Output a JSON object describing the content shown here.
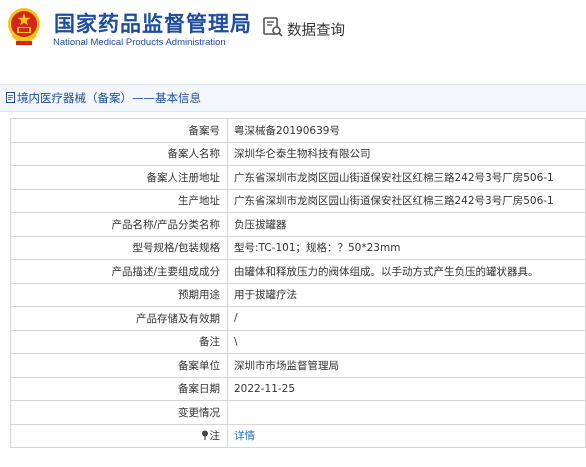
{
  "header": {
    "title_cn": "国家药品监督管理局",
    "title_en": "National Medical Products Administration",
    "search_label": "数据查询",
    "emblem_icon": "national-emblem-icon",
    "search_icon": "search-document-icon"
  },
  "section": {
    "title": "境内医疗器械（备案）——基本信息",
    "icon": "document-icon"
  },
  "rows": [
    {
      "label": "备案号",
      "value": "粤深械备20190639号"
    },
    {
      "label": "备案人名称",
      "value": "深圳华仑泰生物科技有限公司"
    },
    {
      "label": "备案人注册地址",
      "value": "广东省深圳市龙岗区园山街道保安社区红棉三路242号3号厂房506-1"
    },
    {
      "label": "生产地址",
      "value": "广东省深圳市龙岗区园山街道保安社区红棉三路242号3号厂房506-1"
    },
    {
      "label": "产品名称/产品分类名称",
      "value": "负压拔罐器"
    },
    {
      "label": "型号规格/包装规格",
      "value": "型号:TC-101；规格：？50*23mm"
    },
    {
      "label": "产品描述/主要组成成分",
      "value": "由罐体和释放压力的阀体组成。以手动方式产生负压的罐状器具。"
    },
    {
      "label": "预期用途",
      "value": "用于拔罐疗法"
    },
    {
      "label": "产品存储及有效期",
      "value": "/"
    },
    {
      "label": "备注",
      "value": "\\"
    },
    {
      "label": "备案单位",
      "value": "深圳市市场监督管理局"
    },
    {
      "label": "备案日期",
      "value": "2022-11-25"
    },
    {
      "label": "变更情况",
      "value": ""
    },
    {
      "label": "注",
      "value": "详情",
      "icon": "pin-icon"
    }
  ],
  "colors": {
    "brand_blue": "#1c4d9e",
    "emblem_red": "#d4251c",
    "emblem_gold": "#f5c518",
    "link_blue": "#2a72c0",
    "section_bg": "#f3f7fb",
    "border": "#d6d6d6"
  }
}
